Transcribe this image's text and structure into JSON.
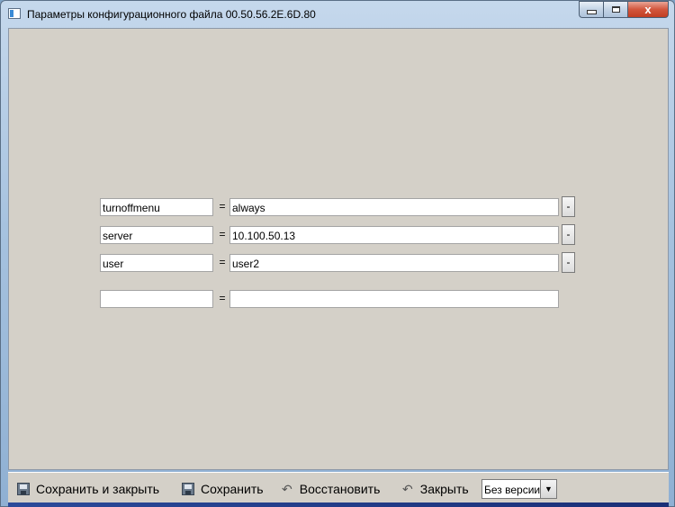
{
  "window": {
    "title": "Параметры конфигурационного файла 00.50.56.2E.6D.80",
    "close_glyph": "x"
  },
  "rows": [
    {
      "key": "turnoffmenu",
      "eq": "=",
      "value": "always",
      "delete_label": "-"
    },
    {
      "key": "server",
      "eq": "=",
      "value": "10.100.50.13",
      "delete_label": "-"
    },
    {
      "key": "user",
      "eq": "=",
      "value": "user2",
      "delete_label": "-"
    }
  ],
  "new_row": {
    "key": "",
    "eq": "=",
    "value": ""
  },
  "toolbar": {
    "save_close_label": "Сохранить и закрыть",
    "save_label": "Сохранить",
    "restore_label": "Восстановить",
    "close_label": "Закрыть",
    "version_selected": "Без версии",
    "dropdown_arrow": "▼",
    "undo_glyph": "↶"
  },
  "icons": {
    "app": "window-icon",
    "save_close": "floppy-close-icon",
    "save": "floppy-icon",
    "restore": "undo-icon",
    "close": "undo-icon"
  },
  "colors": {
    "client_bg": "#d4d0c8",
    "close_btn": "#c8472b",
    "title_gradient_top": "#c5d8ec"
  }
}
